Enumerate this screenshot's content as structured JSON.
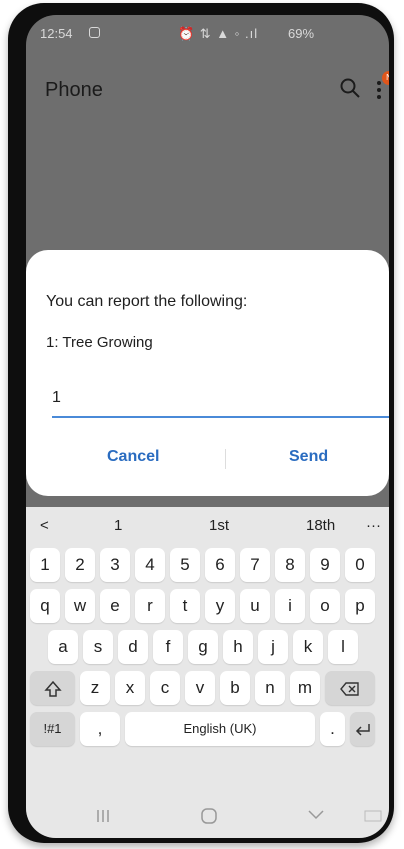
{
  "status_bar": {
    "time": "12:54",
    "battery": "69%",
    "icons": "⏰ ⇅ ▲ ◦ .ıl"
  },
  "app": {
    "title": "Phone",
    "badge": "N"
  },
  "dialog": {
    "message": "You can report the following:",
    "option": "1: Tree Growing",
    "input_value": "1",
    "cancel_label": "Cancel",
    "send_label": "Send"
  },
  "keyboard": {
    "suggestions": [
      "1",
      "1st",
      "18th"
    ],
    "back": "<",
    "more": "···",
    "number_row": [
      "1",
      "2",
      "3",
      "4",
      "5",
      "6",
      "7",
      "8",
      "9",
      "0"
    ],
    "row1": [
      "q",
      "w",
      "e",
      "r",
      "t",
      "y",
      "u",
      "i",
      "o",
      "p"
    ],
    "row2": [
      "a",
      "s",
      "d",
      "f",
      "g",
      "h",
      "j",
      "k",
      "l"
    ],
    "row3": [
      "z",
      "x",
      "c",
      "v",
      "b",
      "n",
      "m"
    ],
    "symbols_label": "!#1",
    "comma": ",",
    "space_label": "English (UK)",
    "period": "."
  }
}
